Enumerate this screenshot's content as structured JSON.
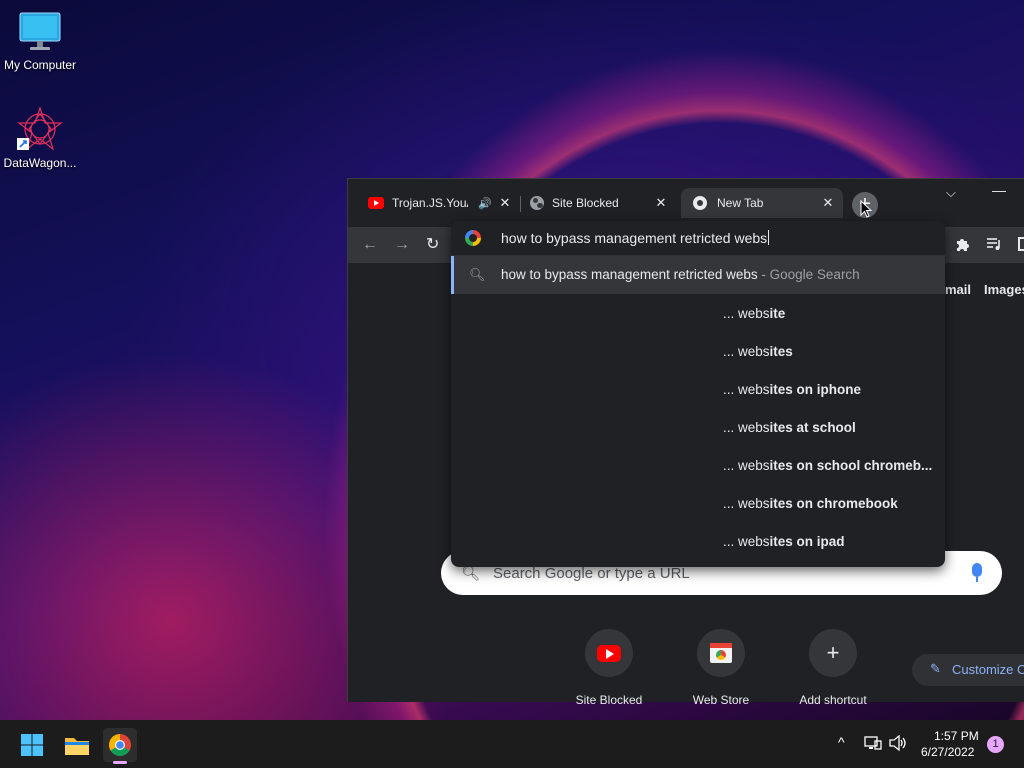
{
  "desktop": {
    "icons": [
      {
        "label": "My Computer"
      },
      {
        "label": "DataWagon..."
      }
    ]
  },
  "browser": {
    "tabs": [
      {
        "title": "Trojan.JS.YouA",
        "icon": "youtube-icon",
        "audio": true
      },
      {
        "title": "Site Blocked",
        "icon": "globe-icon"
      },
      {
        "title": "New Tab",
        "icon": "chrome-icon",
        "active": true
      }
    ],
    "omnibox": {
      "value": "how to bypass management retricted webs"
    },
    "suggestions": {
      "main": {
        "text": "how to bypass management retricted webs",
        "suffix": " - Google Search"
      },
      "items": [
        {
          "prefix": "... webs",
          "bold": "ite"
        },
        {
          "prefix": "... webs",
          "bold": "ites"
        },
        {
          "prefix": "... webs",
          "bold": "ites on iphone"
        },
        {
          "prefix": "... webs",
          "bold": "ites at school"
        },
        {
          "prefix": "... webs",
          "bold": "ites on school chromeb..."
        },
        {
          "prefix": "... webs",
          "bold": "ites on chromebook"
        },
        {
          "prefix": "... webs",
          "bold": "ites on ipad"
        }
      ]
    },
    "ntp": {
      "links": {
        "gmail": "mail",
        "images": "Images"
      },
      "search_placeholder": "Search Google or type a URL",
      "shortcuts": [
        {
          "label": "Site Blocked",
          "icon": "youtube-icon"
        },
        {
          "label": "Web Store",
          "icon": "web-store-icon"
        },
        {
          "label": "Add shortcut",
          "icon": "plus-icon"
        }
      ],
      "customize_label": "Customize C"
    }
  },
  "taskbar": {
    "time": "1:57 PM",
    "date": "6/27/2022",
    "notification_count": "1"
  },
  "colors": {
    "accent": "#8ab4f8",
    "chrome_dark": "#202124",
    "toolbar": "#35363a",
    "youtube_red": "#ff0000"
  }
}
